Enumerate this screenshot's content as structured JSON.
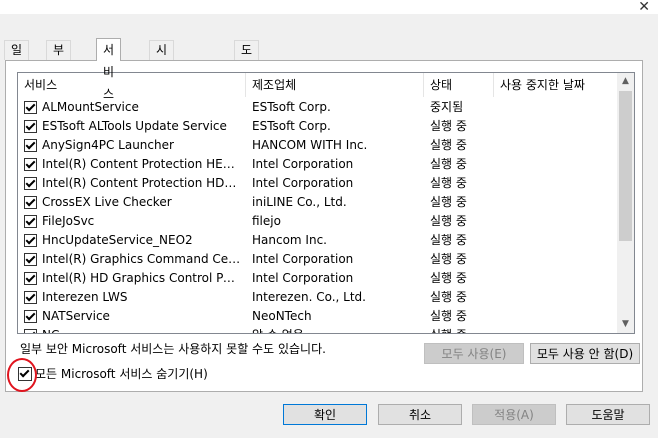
{
  "window": {
    "close_glyph": "✕"
  },
  "tabs": [
    {
      "label": "일반"
    },
    {
      "label": "부팅"
    },
    {
      "label": "서비스"
    },
    {
      "label": "시작프로그램"
    },
    {
      "label": "도구"
    }
  ],
  "columns": {
    "service": "서비스",
    "manufacturer": "제조업체",
    "status": "상태",
    "disabled_date": "사용 중지한 날짜"
  },
  "rows": [
    {
      "name": "ALMountService",
      "maker": "ESTsoft Corp.",
      "status": "중지됨"
    },
    {
      "name": "ESTsoft ALTools Update Service",
      "maker": "ESTsoft Corp.",
      "status": "실행 중"
    },
    {
      "name": "AnySign4PC Launcher",
      "maker": "HANCOM WITH Inc.",
      "status": "실행 중"
    },
    {
      "name": "Intel(R) Content Protection HECI Se...",
      "maker": "Intel Corporation",
      "status": "실행 중"
    },
    {
      "name": "Intel(R) Content Protection HDCP S...",
      "maker": "Intel Corporation",
      "status": "실행 중"
    },
    {
      "name": "CrossEX Live Checker",
      "maker": "iniLINE Co., Ltd.",
      "status": "실행 중"
    },
    {
      "name": "FileJoSvc",
      "maker": "filejo",
      "status": "실행 중"
    },
    {
      "name": "HncUpdateService_NEO2",
      "maker": "Hancom Inc.",
      "status": "실행 중"
    },
    {
      "name": "Intel(R) Graphics Command Center ...",
      "maker": "Intel Corporation",
      "status": "실행 중"
    },
    {
      "name": "Intel(R) HD Graphics Control Panel ...",
      "maker": "Intel Corporation",
      "status": "실행 중"
    },
    {
      "name": "Interezen LWS",
      "maker": "Interezen. Co., Ltd.",
      "status": "실행 중"
    },
    {
      "name": "NATService",
      "maker": "NeoNTech",
      "status": "실행 중"
    },
    {
      "name": "NC...",
      "maker": "알 수 없음",
      "status": "실행 중"
    }
  ],
  "note": "일부 보안 Microsoft 서비스는 사용하지 못할 수도 있습니다.",
  "buttons": {
    "enable_all": "모두 사용(E)",
    "disable_all": "모두 사용 안 함(D)",
    "ok": "확인",
    "cancel": "취소",
    "apply": "적용(A)",
    "help": "도움말"
  },
  "hide_ms_label": "모든 Microsoft 서비스 숨기기(H)",
  "colors": {
    "annotation": "#e0141e",
    "focus": "#0078d7"
  }
}
